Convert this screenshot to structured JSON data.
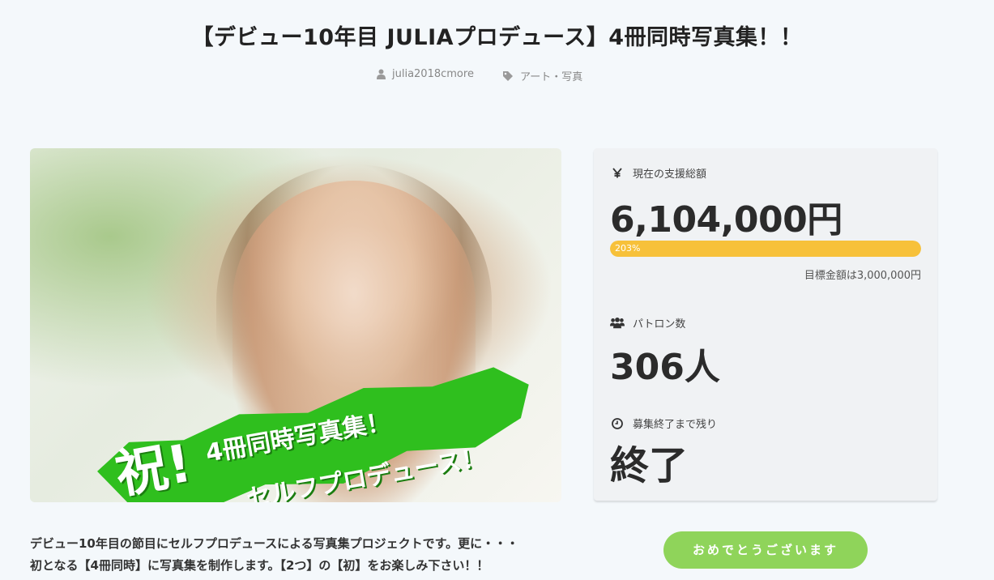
{
  "project": {
    "title": "【デビュー10年目 JULIAプロデュース】4冊同時写真集！！",
    "author": "julia2018cmore",
    "category": "アート・写真"
  },
  "hero_image": {
    "overlay_big": "祝!",
    "overlay_line1": "4冊同時写真集！",
    "overlay_line2": "セルフプロデュース！"
  },
  "stats": {
    "funding_label": "現在の支援総額",
    "funding_icon": "yen-icon",
    "funding_amount": "6,104,000円",
    "progress_percent": 203,
    "progress_label": "203%",
    "goal_text": "目標金額は3,000,000円",
    "patrons_label": "パトロン数",
    "patrons_icon": "users-icon",
    "patrons_count": "306人",
    "remaining_label": "募集終了まで残り",
    "remaining_icon": "clock-icon",
    "remaining_value": "終了"
  },
  "description": {
    "line1": "デビュー10年目の節目にセルフプロデュースによる写真集プロジェクトです。更に・・・",
    "line2": "初となる【4冊同時】に写真集を制作します。【2つ】の【初】をお楽しみ下さい！！"
  },
  "cta": {
    "label": "おめでとうございます"
  },
  "colors": {
    "accent_green": "#8fd45a",
    "progress_yellow": "#f7c13a",
    "background": "#f4f8fb"
  }
}
